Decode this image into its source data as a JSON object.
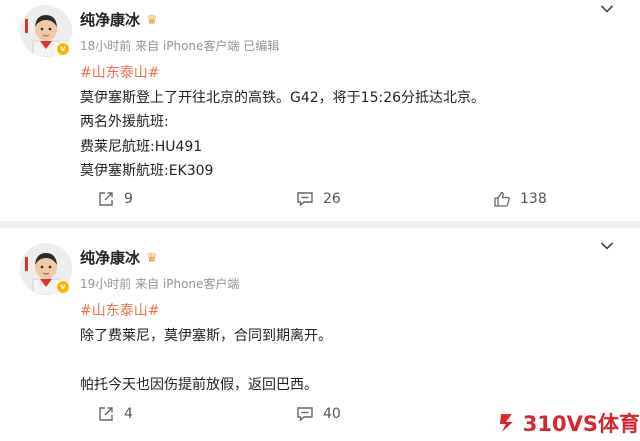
{
  "posts": [
    {
      "author": "纯净康冰",
      "meta": "18小时前 来自 iPhone客户端 已编辑",
      "lines": [
        "#山东泰山#",
        "莫伊塞斯登上了开往北京的高铁。G42，将于15:26分抵达北京。",
        "两名外援航班:",
        "费莱尼航班:HU491",
        "莫伊塞斯航班:EK309"
      ],
      "share_count": "9",
      "comment_count": "26",
      "like_count": "138"
    },
    {
      "author": "纯净康冰",
      "meta": "19小时前 来自 iPhone客户端",
      "lines": [
        "#山东泰山#",
        "除了费莱尼，莫伊塞斯，合同到期离开。",
        "",
        "帕托今天也因伤提前放假，返回巴西。"
      ],
      "share_count": "4",
      "comment_count": "40"
    }
  ],
  "watermark": {
    "text": "310VS体育"
  },
  "colors": {
    "topic": "#eb7350",
    "meta": "#939393",
    "watermark": "#d9262a"
  }
}
